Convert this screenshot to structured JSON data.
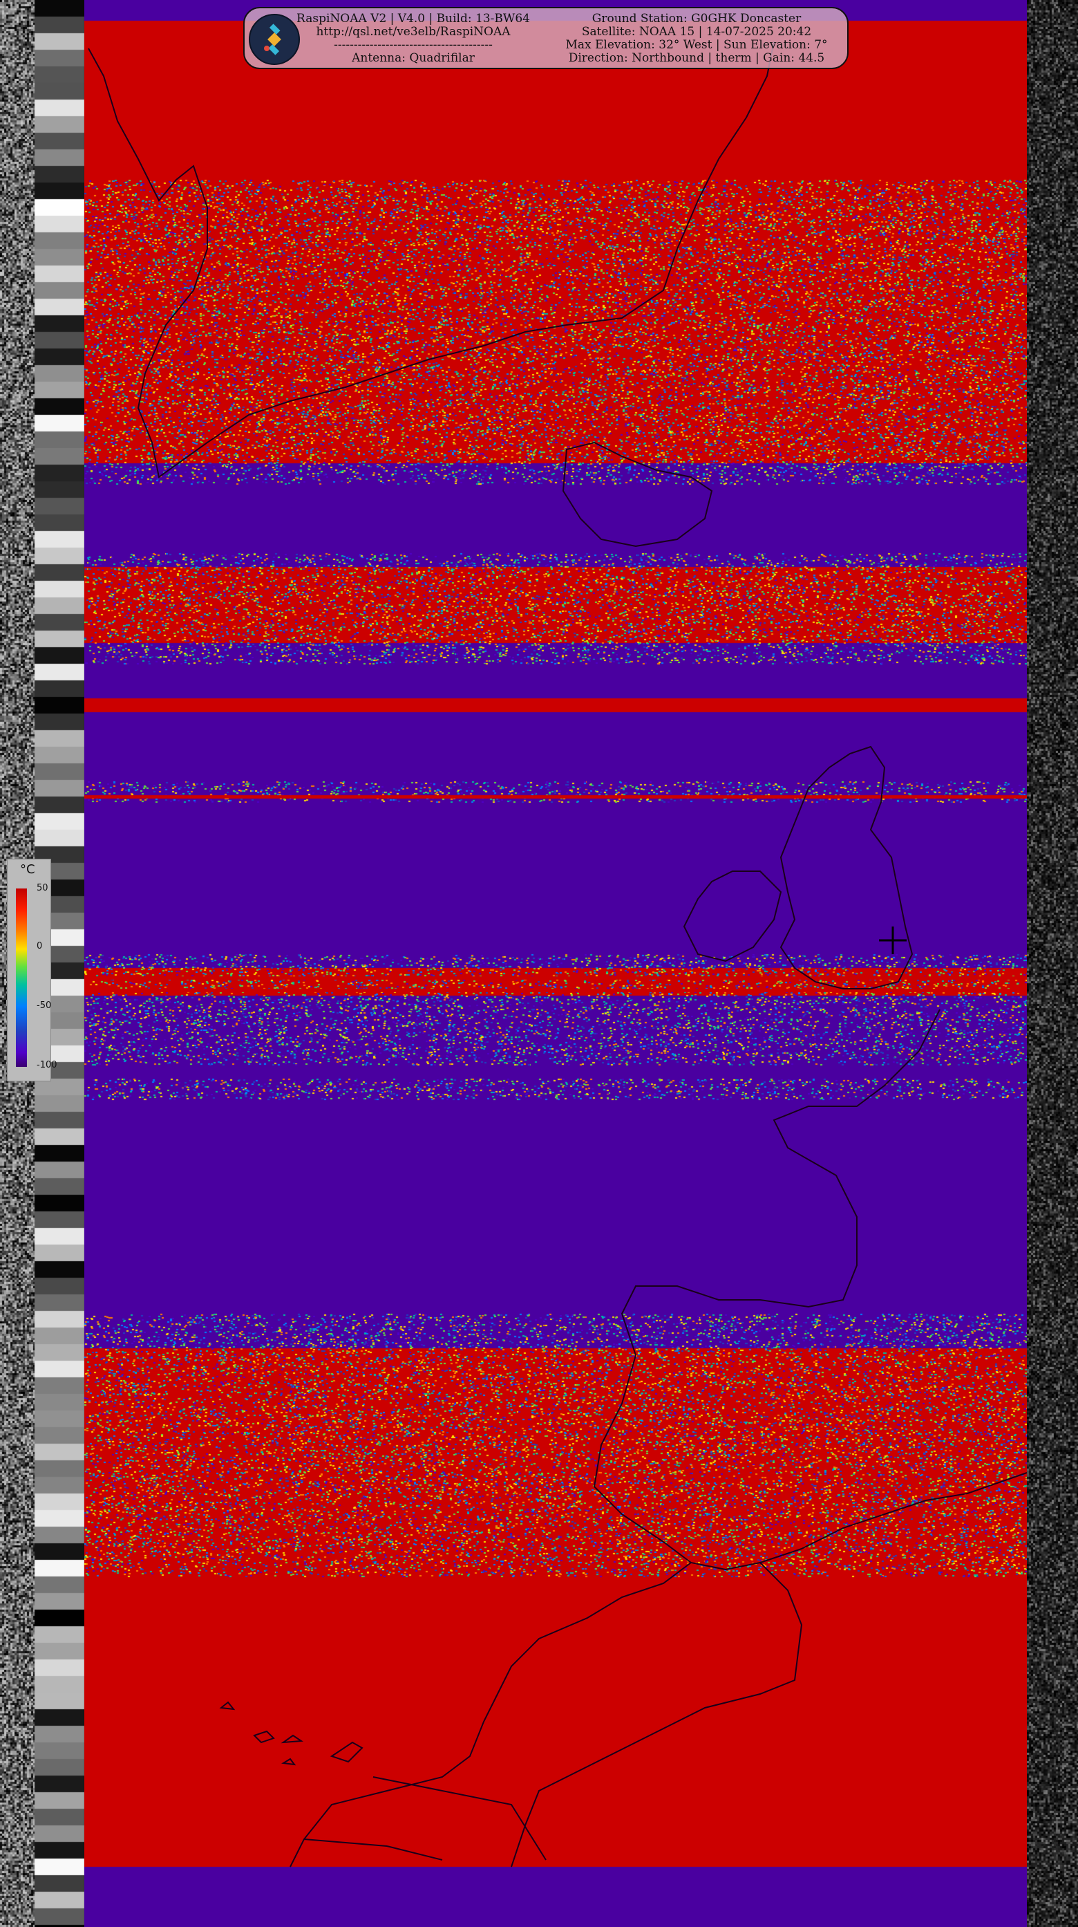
{
  "header": {
    "left_lines": [
      "RaspiNOAA V2 | V4.0 | Build: 13-BW64",
      "http://qsl.net/ve3elb/RaspiNOAA",
      "----------------------------------------",
      "Antenna: Quadrifilar"
    ],
    "right_lines": [
      "Ground Station: G0GHK Doncaster",
      "Satellite: NOAA 15 | 14-07-2025 20:42",
      "Max Elevation: 32° West | Sun Elevation: 7°",
      "Direction: Northbound | therm | Gain: 44.5"
    ],
    "logo_icon": "satellite-icon"
  },
  "legend": {
    "unit": "°C",
    "ticks": [
      "50",
      "0",
      "-50",
      "-100"
    ]
  },
  "colors": {
    "warm_red": "#cc0000",
    "cold_purple": "#4a00a0",
    "overlay": "#d2aabe"
  }
}
